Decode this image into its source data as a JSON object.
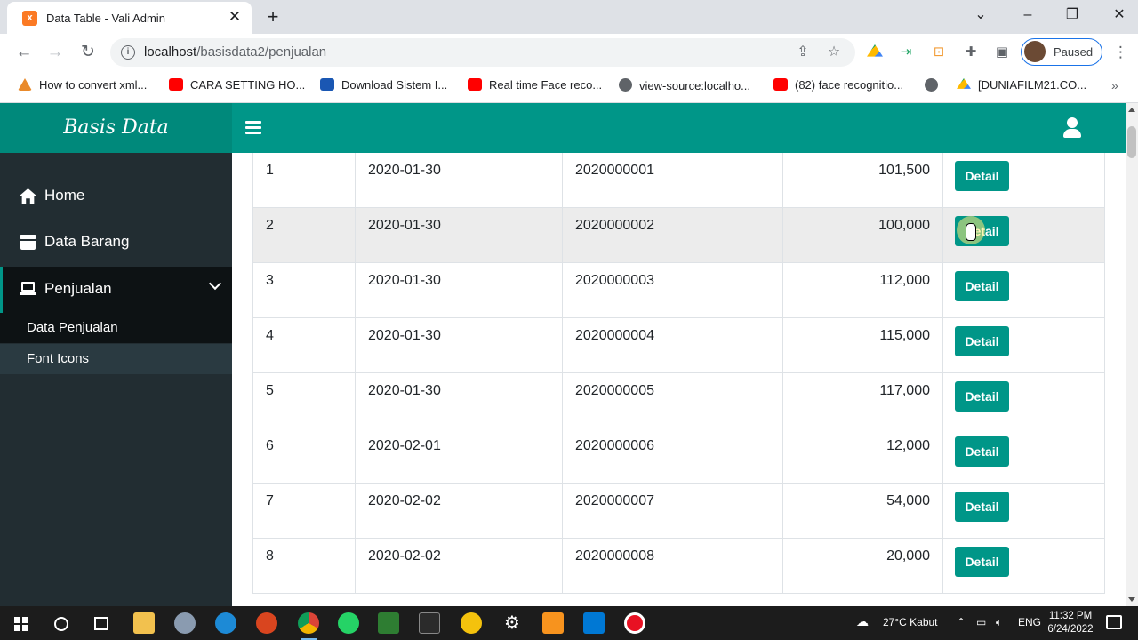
{
  "browser": {
    "tab_title": "Data Table - Vali Admin",
    "tab_favicon": "x",
    "url_host": "localhost",
    "url_path": "/basisdata2/penjualan",
    "profile_status": "Paused",
    "bookmarks": [
      {
        "label": "How to convert xml...",
        "icon": "flame"
      },
      {
        "label": "CARA SETTING HO...",
        "icon": "youtube"
      },
      {
        "label": "Download Sistem I...",
        "icon": "book"
      },
      {
        "label": "Real time Face reco...",
        "icon": "youtube"
      },
      {
        "label": "view-source:localho...",
        "icon": "globe"
      },
      {
        "label": "(82) face recognitio...",
        "icon": "youtube"
      },
      {
        "label": "",
        "icon": "globe"
      },
      {
        "label": "[DUNIAFILM21.CO...",
        "icon": "drive"
      }
    ]
  },
  "app": {
    "brand": "Basis Data",
    "accent_color": "#009688",
    "sidebar_bg": "#222d32"
  },
  "sidebar": {
    "items": [
      {
        "label": "Home",
        "icon": "home-icon"
      },
      {
        "label": "Data Barang",
        "icon": "archive-icon"
      },
      {
        "label": "Penjualan",
        "icon": "laptop-icon",
        "expanded": true
      }
    ],
    "submenu": [
      {
        "label": "Data Penjualan",
        "active": true
      },
      {
        "label": "Font Icons",
        "active": false
      }
    ]
  },
  "table": {
    "action_label": "Detail",
    "rows": [
      {
        "no": "1",
        "date": "2020-01-30",
        "code": "2020000001",
        "total": "101,500"
      },
      {
        "no": "2",
        "date": "2020-01-30",
        "code": "2020000002",
        "total": "100,000"
      },
      {
        "no": "3",
        "date": "2020-01-30",
        "code": "2020000003",
        "total": "112,000"
      },
      {
        "no": "4",
        "date": "2020-01-30",
        "code": "2020000004",
        "total": "115,000"
      },
      {
        "no": "5",
        "date": "2020-01-30",
        "code": "2020000005",
        "total": "117,000"
      },
      {
        "no": "6",
        "date": "2020-02-01",
        "code": "2020000006",
        "total": "12,000"
      },
      {
        "no": "7",
        "date": "2020-02-02",
        "code": "2020000007",
        "total": "54,000"
      },
      {
        "no": "8",
        "date": "2020-02-02",
        "code": "2020000008",
        "total": "20,000"
      }
    ]
  },
  "taskbar": {
    "weather": "27°C  Kabut",
    "language": "ENG",
    "time": "11:32 PM",
    "date": "6/24/2022"
  }
}
